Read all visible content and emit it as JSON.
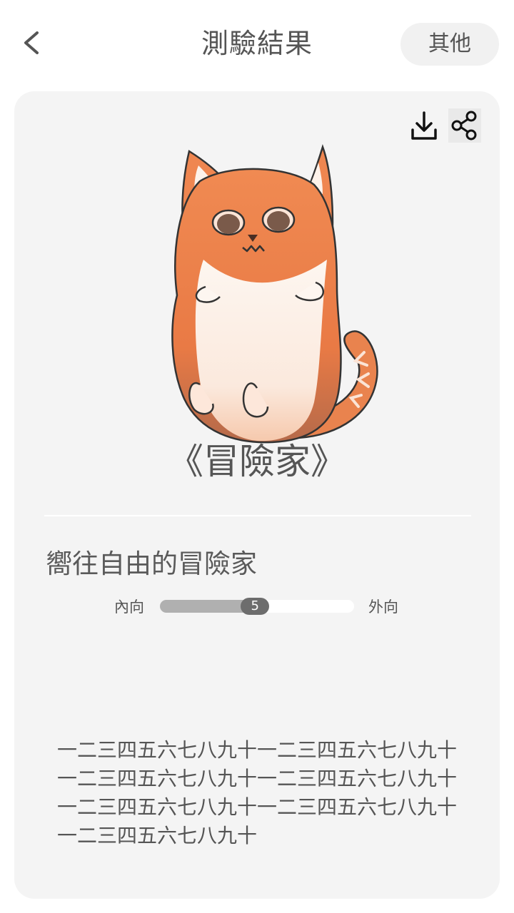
{
  "header": {
    "title": "測驗結果",
    "other_button_label": "其他"
  },
  "card": {
    "result_title": "《冒險家》",
    "subtitle": "嚮往自由的冒險家",
    "scale": {
      "left_label": "內向",
      "right_label": "外向",
      "value": "5",
      "fill_fraction": 0.49
    },
    "description": "一二三四五六七八九十一二三四五六七八九十一二三四五六七八九十一二三四五六七八九十一二三四五六七八九十一二三四五六七八九十一二三四五六七八九十"
  },
  "icons": {
    "back": "chevron-left-icon",
    "download": "download-icon",
    "share": "share-icon"
  },
  "colors": {
    "card_background": "#f4f4f4",
    "cat_orange": "#ee8450",
    "slider_fill": "#b0b0b0",
    "slider_thumb": "#6d6d6d"
  }
}
